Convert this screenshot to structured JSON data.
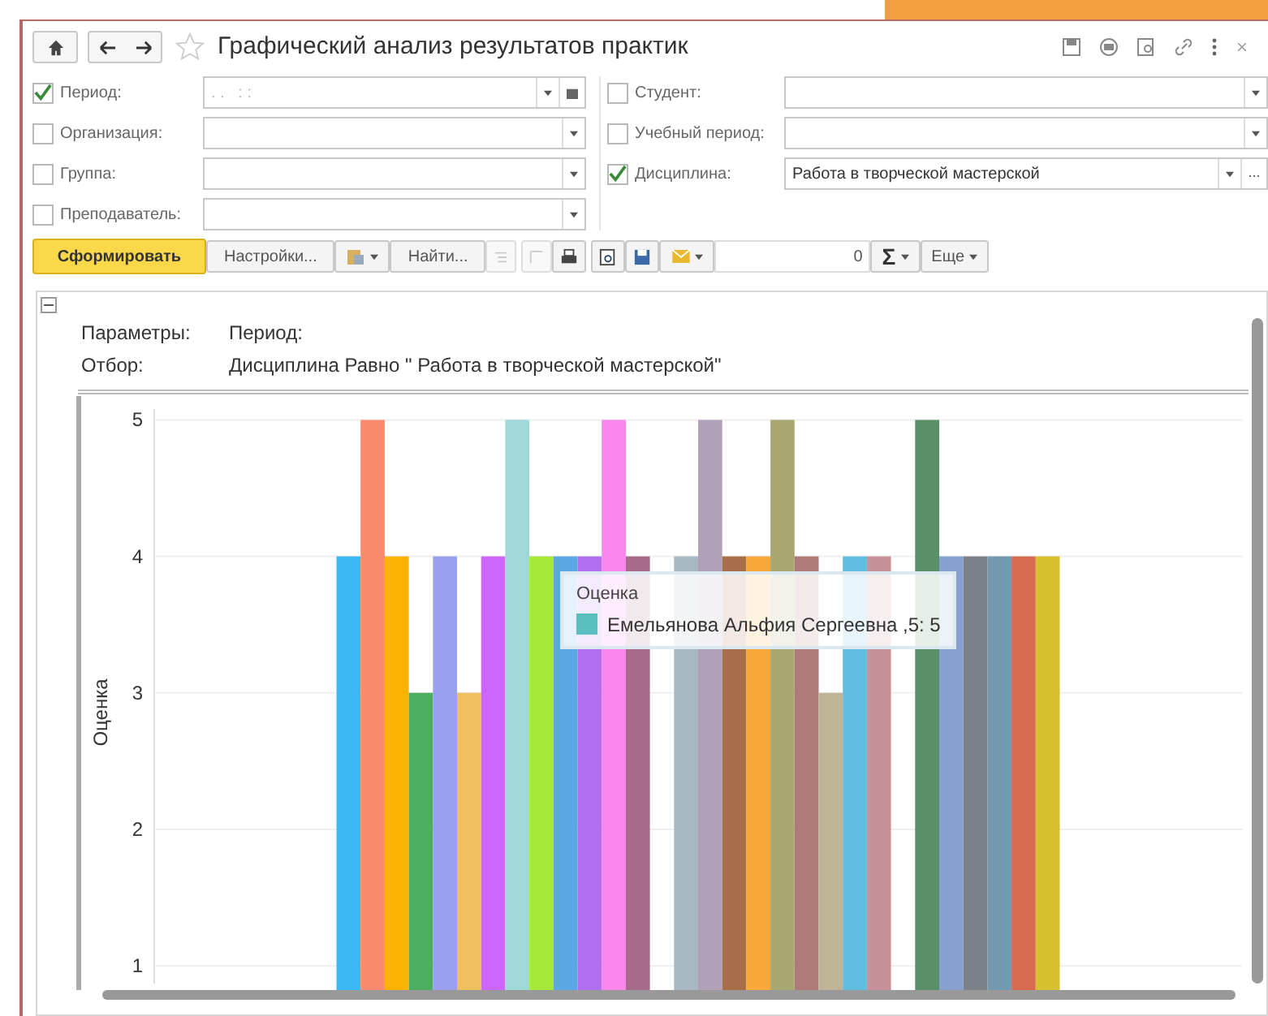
{
  "window": {
    "title": "Графический анализ результатов практик"
  },
  "filters_left": [
    {
      "label": "Период:",
      "checked": true,
      "placeholder": ". .   : :",
      "kind": "period"
    },
    {
      "label": "Организация:",
      "checked": false,
      "kind": "choice"
    },
    {
      "label": "Группа:",
      "checked": false,
      "kind": "choice"
    },
    {
      "label": "Преподаватель:",
      "checked": false,
      "kind": "choice"
    }
  ],
  "filters_right": [
    {
      "label": "Студент:",
      "checked": false,
      "kind": "choice"
    },
    {
      "label": "Учебный период:",
      "checked": false,
      "kind": "choice"
    },
    {
      "label": "Дисциплина:",
      "checked": true,
      "value": "Работа в творческой мастерской",
      "kind": "choice_more",
      "more": "..."
    }
  ],
  "toolbar": [
    {
      "kind": "primary",
      "label": "Сформировать"
    },
    {
      "kind": "button",
      "label": "Настройки..."
    },
    {
      "kind": "paste_menu"
    },
    {
      "kind": "button",
      "label": "Найти..."
    },
    {
      "kind": "group_disabled"
    },
    {
      "kind": "print_group"
    },
    {
      "kind": "save"
    },
    {
      "kind": "mail_menu"
    },
    {
      "kind": "number",
      "value": "0"
    },
    {
      "kind": "sum_menu",
      "label": "Σ"
    },
    {
      "kind": "menu",
      "label": "Еще"
    }
  ],
  "report": {
    "parameters": [
      {
        "label": "Параметры:",
        "value": "Период:"
      },
      {
        "label": "Отбор:",
        "value": "Дисциплина Равно \" Работа в творческой мастерской\""
      }
    ],
    "chart_data": {
      "type": "bar",
      "grid": true,
      "ylabel": "Оценка",
      "ylim": [
        0.87,
        5.08
      ],
      "yticks": [
        1,
        2,
        3,
        4,
        5
      ],
      "series": [
        {
          "color": "#3bb9f5",
          "values": [
            4
          ]
        },
        {
          "color": "#fb8a6e",
          "values": [
            5
          ]
        },
        {
          "color": "#fbb200",
          "values": [
            4
          ]
        },
        {
          "color": "#4caf60",
          "values": [
            3
          ]
        },
        {
          "color": "#9b9ff0",
          "values": [
            4
          ]
        },
        {
          "color": "#eec060",
          "values": [
            3
          ]
        },
        {
          "color": "#cc66ff",
          "values": [
            4
          ]
        },
        {
          "color": "#9ed9d8",
          "values": [
            5
          ]
        },
        {
          "color": "#a6e83a",
          "values": [
            4
          ]
        },
        {
          "color": "#5aa7e6",
          "values": [
            4
          ]
        },
        {
          "color": "#b070ee",
          "values": [
            4
          ]
        },
        {
          "color": "#f986ea",
          "values": [
            5
          ]
        },
        {
          "color": "#a86a8a",
          "values": [
            4
          ]
        },
        {
          "values": [
            null
          ]
        },
        {
          "color": "#a8b8c2",
          "values": [
            4
          ]
        },
        {
          "color": "#b0a0b8",
          "values": [
            5
          ]
        },
        {
          "color": "#a86e48",
          "values": [
            4
          ]
        },
        {
          "color": "#f8a838",
          "values": [
            4
          ]
        },
        {
          "color": "#a8a870",
          "values": [
            5
          ]
        },
        {
          "color": "#b07a78",
          "values": [
            4
          ]
        },
        {
          "color": "#c0b498",
          "values": [
            3
          ]
        },
        {
          "color": "#60bde0",
          "values": [
            4
          ]
        },
        {
          "color": "#c89098",
          "values": [
            4
          ]
        },
        {
          "values": [
            null
          ]
        },
        {
          "color": "#5a9068",
          "values": [
            5
          ]
        },
        {
          "color": "#88a0d0",
          "values": [
            4
          ]
        },
        {
          "color": "#7c8088",
          "values": [
            4
          ]
        },
        {
          "color": "#7498ae",
          "values": [
            4
          ]
        },
        {
          "color": "#d86a50",
          "values": [
            4
          ]
        },
        {
          "color": "#d8c030",
          "values": [
            4
          ]
        }
      ]
    },
    "tooltip": {
      "title": "Оценка",
      "color": "#5bbfc0",
      "text": "Емельянова Альфия Сергеевна ,5: 5"
    }
  }
}
